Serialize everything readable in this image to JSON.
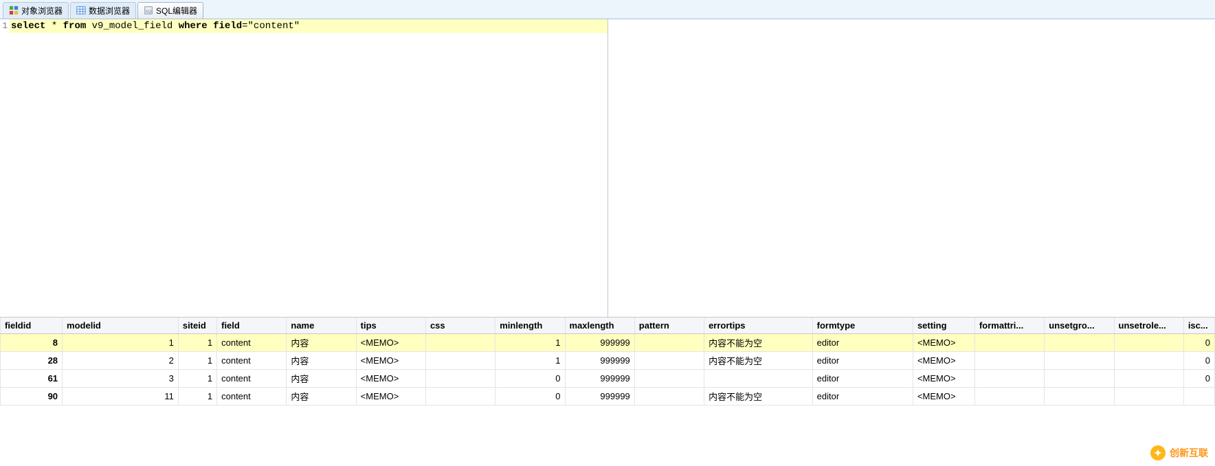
{
  "tabs": {
    "object_browser": "对象浏览器",
    "data_browser": "数据浏览器",
    "sql_editor": "SQL编辑器",
    "active_index": 2
  },
  "editor": {
    "line_number": "1",
    "kw_select": "select",
    "star": " * ",
    "kw_from": "from",
    "sp1": " ",
    "table": "v9_model_field",
    "sp2": " ",
    "kw_where": "where",
    "sp3": " ",
    "kw_field": "field",
    "eq": "=",
    "value": "\"content\""
  },
  "columns": {
    "fieldid": "fieldid",
    "modelid": "modelid",
    "siteid": "siteid",
    "field": "field",
    "name": "name",
    "tips": "tips",
    "css": "css",
    "minlength": "minlength",
    "maxlength": "maxlength",
    "pattern": "pattern",
    "errortips": "errortips",
    "formtype": "formtype",
    "setting": "setting",
    "formattri": "formattri...",
    "unsetgro": "unsetgro...",
    "unsetrole": "unsetrole...",
    "isc": "isc..."
  },
  "rows": [
    {
      "fieldid": "8",
      "modelid": "1",
      "siteid": "1",
      "field": "content",
      "name": "内容",
      "tips": "<MEMO>",
      "css": "",
      "minlength": "1",
      "maxlength": "999999",
      "pattern": "",
      "errortips": "内容不能为空",
      "formtype": "editor",
      "setting": "<MEMO>",
      "formattri": "",
      "unsetgro": "",
      "unsetrole": "",
      "isc": "0",
      "selected": true
    },
    {
      "fieldid": "28",
      "modelid": "2",
      "siteid": "1",
      "field": "content",
      "name": "内容",
      "tips": "<MEMO>",
      "css": "",
      "minlength": "1",
      "maxlength": "999999",
      "pattern": "",
      "errortips": "内容不能为空",
      "formtype": "editor",
      "setting": "<MEMO>",
      "formattri": "",
      "unsetgro": "",
      "unsetrole": "",
      "isc": "0",
      "selected": false
    },
    {
      "fieldid": "61",
      "modelid": "3",
      "siteid": "1",
      "field": "content",
      "name": "内容",
      "tips": "<MEMO>",
      "css": "",
      "minlength": "0",
      "maxlength": "999999",
      "pattern": "",
      "errortips": "",
      "formtype": "editor",
      "setting": "<MEMO>",
      "formattri": "",
      "unsetgro": "",
      "unsetrole": "",
      "isc": "0",
      "selected": false
    },
    {
      "fieldid": "90",
      "modelid": "11",
      "siteid": "1",
      "field": "content",
      "name": "内容",
      "tips": "<MEMO>",
      "css": "",
      "minlength": "0",
      "maxlength": "999999",
      "pattern": "",
      "errortips": "内容不能为空",
      "formtype": "editor",
      "setting": "<MEMO>",
      "formattri": "",
      "unsetgro": "",
      "unsetrole": "",
      "isc": "",
      "selected": false
    }
  ],
  "col_widths": {
    "fieldid": 80,
    "modelid": 150,
    "siteid": 50,
    "field": 90,
    "name": 90,
    "tips": 90,
    "css": 90,
    "minlength": 90,
    "maxlength": 90,
    "pattern": 90,
    "errortips": 140,
    "formtype": 130,
    "setting": 80,
    "formattri": 90,
    "unsetgro": 90,
    "unsetrole": 90,
    "isc": 40
  },
  "watermark": "创新互联"
}
